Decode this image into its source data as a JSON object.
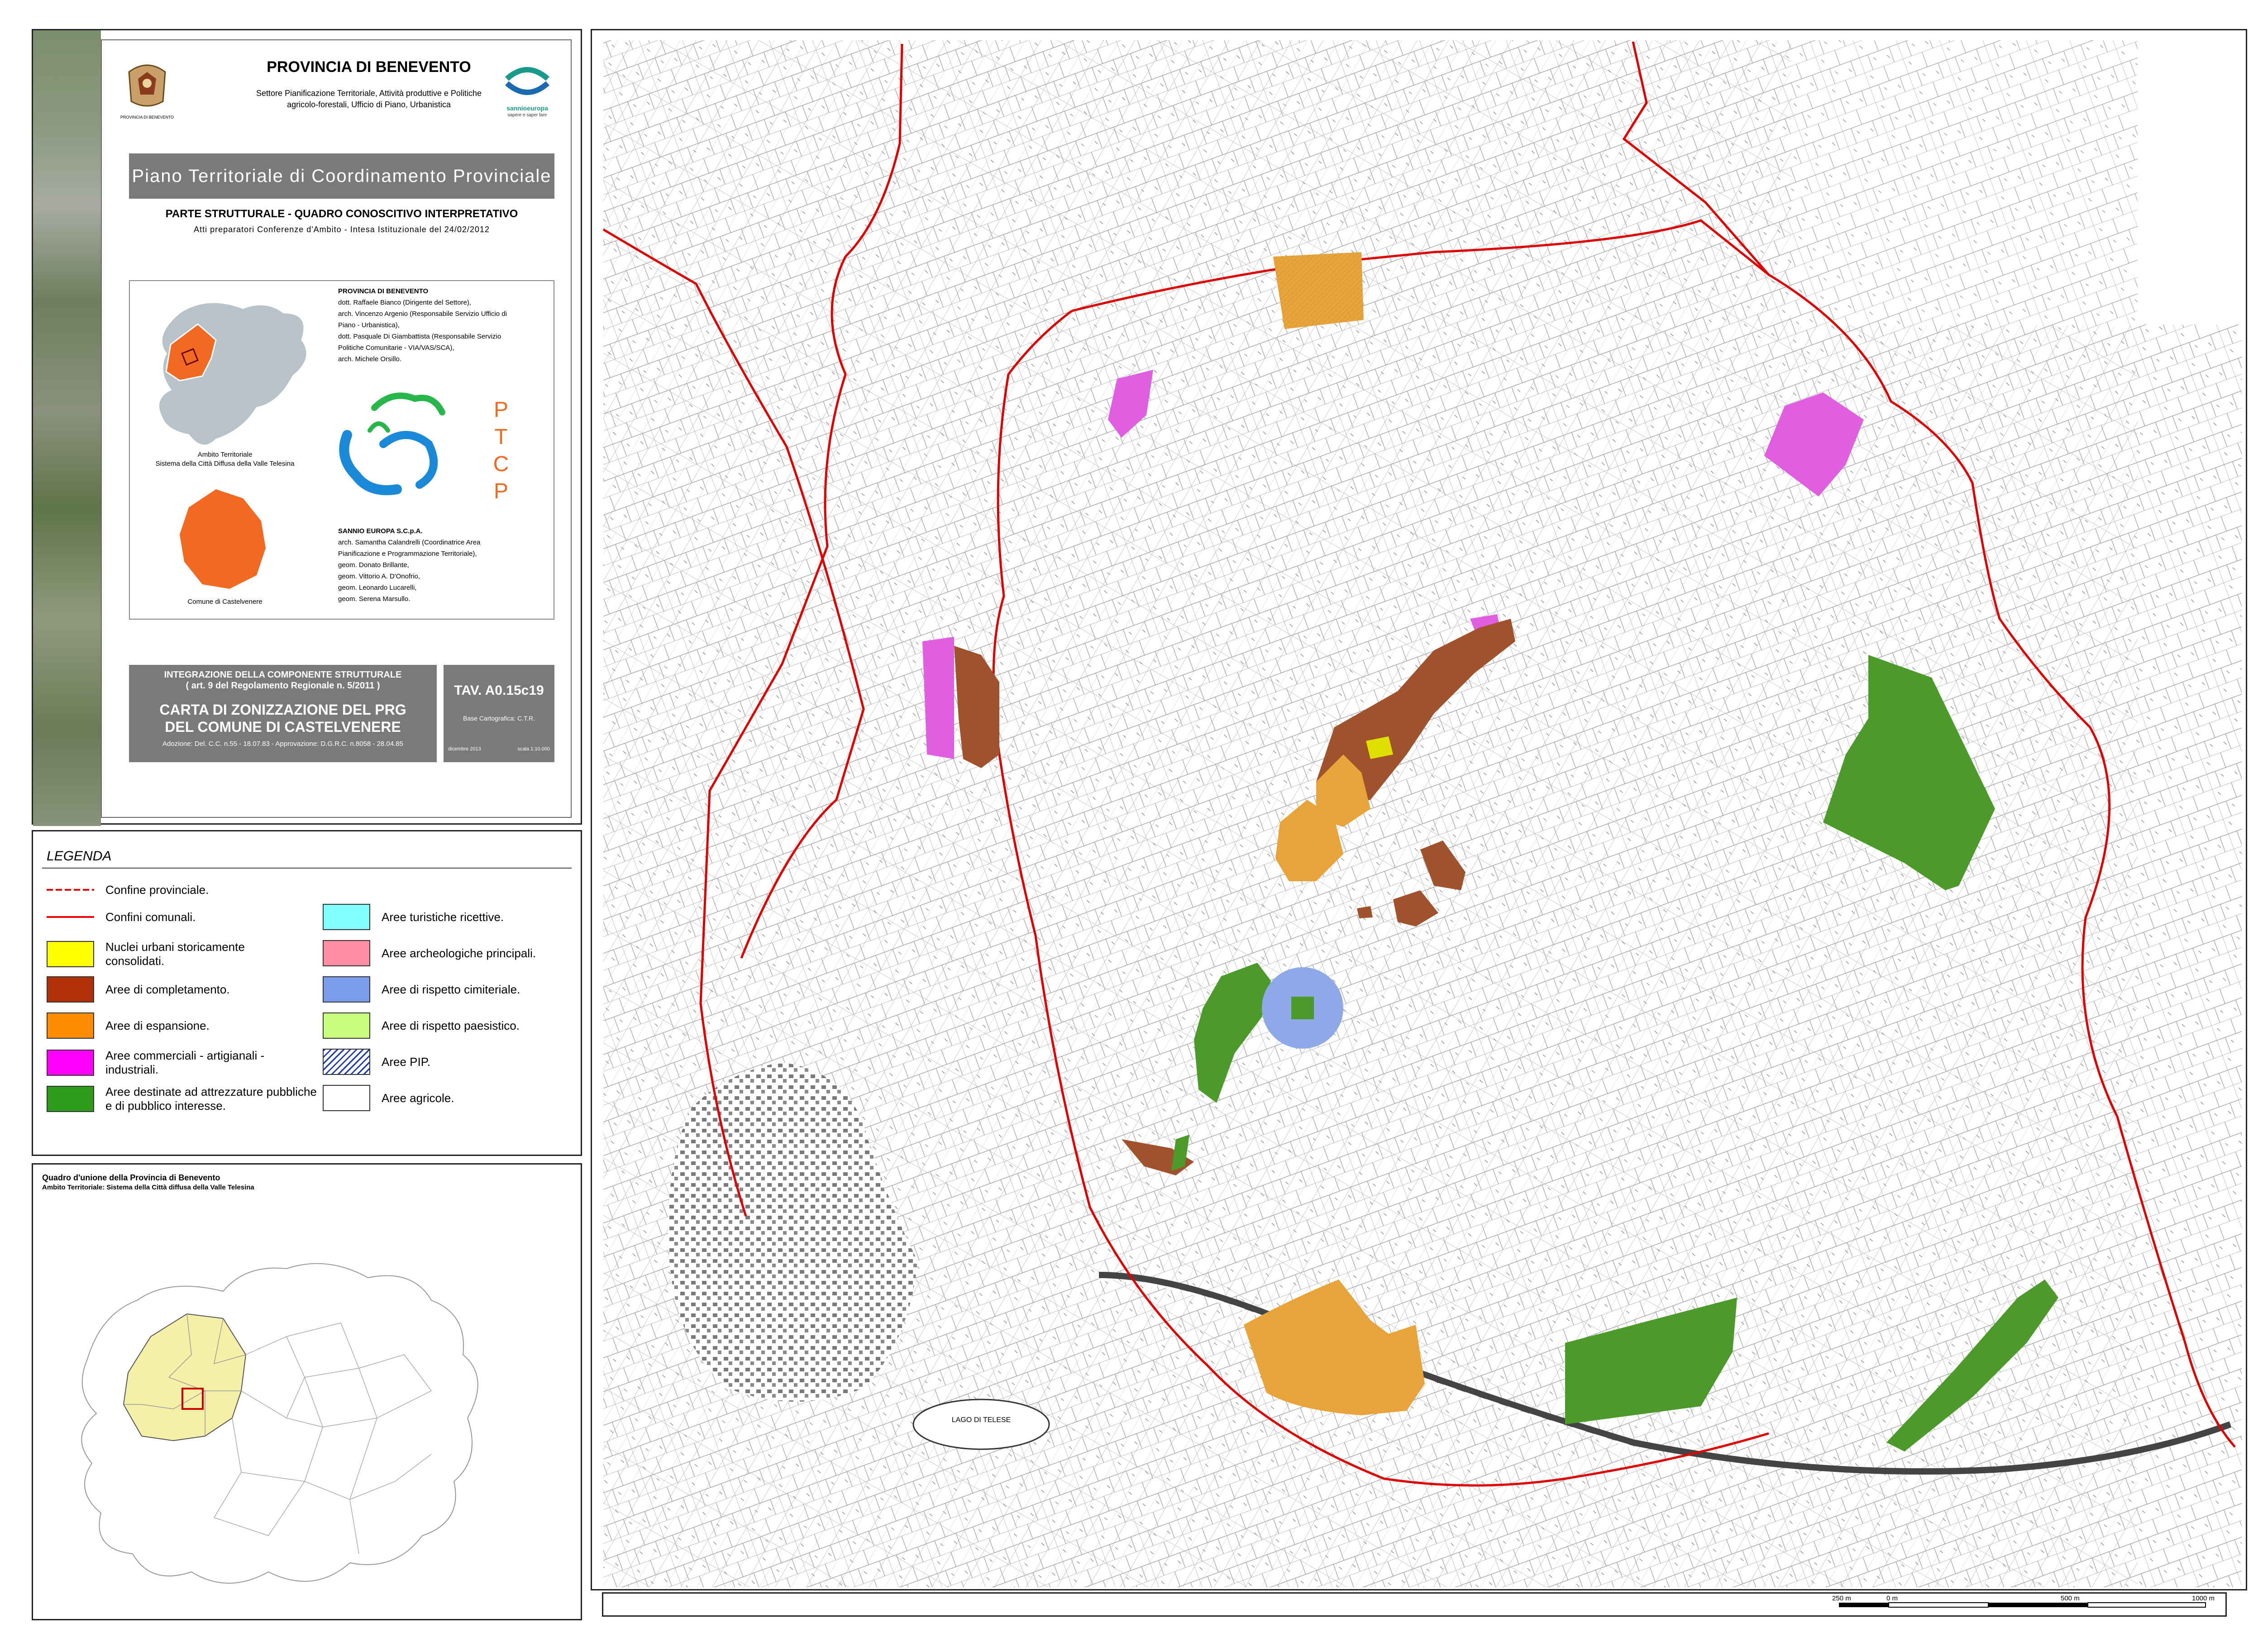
{
  "header": {
    "province": "PROVINCIA DI BENEVENTO",
    "sector": "Settore Pianificazione Territoriale, Attività produttive e Politiche agricolo-forestali, Ufficio di Piano, Urbanistica",
    "crest_caption": "PROVINCIA DI BENEVENTO",
    "logo_name": "sannioeuropa",
    "logo_tagline": "sapere e saper fare",
    "plan_title": "Piano Territoriale di Coordinamento Provinciale",
    "part_title": "PARTE STRUTTURALE - QUADRO CONOSCITIVO INTERPRETATIVO",
    "part_subtitle": "Atti preparatori Conferenze d'Ambito - Intesa Istituzionale del 24/02/2012"
  },
  "info": {
    "province_team_title": "PROVINCIA DI BENEVENTO",
    "province_team": [
      "dott. Raffaele Bianco (Dirigente del Settore),",
      "arch. Vincenzo Argenio (Responsabile Servizio Ufficio di",
      "Piano - Urbanistica),",
      "dott. Pasquale Di Giambattista (Responsabile Servizio",
      "Politiche Comunitarie - VIA/VAS/SCA),",
      "arch. Michele Orsillo."
    ],
    "sannio_team_title": "SANNIO EUROPA S.C.p.A.",
    "sannio_team": [
      "arch. Samantha Calandrelli (Coordinatrice Area",
      "Pianificazione e Programmazione Territoriale),",
      "geom. Donato Brillante,",
      "geom. Vittorio A. D'Onofrio,",
      "geom. Leonardo Lucarelli,",
      "geom. Serena Marsullo."
    ],
    "ambito_caption_1": "Ambito Territoriale",
    "ambito_caption_2": "Sistema della Città Diffusa della Valle Telesina",
    "comune_caption": "Comune di Castelvenere",
    "ptcp_letters": [
      "P",
      "T",
      "C",
      "P"
    ]
  },
  "tav": {
    "integration_1": "INTEGRAZIONE DELLA COMPONENTE STRUTTURALE",
    "integration_2": "( art. 9 del Regolamento Regionale n. 5/2011 )",
    "map_title_1": "CARTA DI ZONIZZAZIONE DEL PRG",
    "map_title_2": "DEL COMUNE DI CASTELVENERE",
    "adoption": "Adozione: Del. C.C. n.55 - 18.07.83 - Approvazione: D.G.R.C. n.8058 - 28.04.85",
    "tav_prefix": "TAV.",
    "tav_code": "A0.15c19",
    "base": "Base Cartografica: C.T.R.",
    "date": "dicembre 2013",
    "scale": "scala 1:10.000"
  },
  "legend": {
    "title": "LEGENDA",
    "lines": [
      {
        "label": "Confine provinciale.",
        "style": "dashed",
        "color": "#e00000"
      },
      {
        "label": "Confini comunali.",
        "style": "solid",
        "color": "#e00000"
      }
    ],
    "left_items": [
      {
        "label": "Nuclei urbani storicamente consolidati.",
        "color": "#ffff00"
      },
      {
        "label": "Aree di completamento.",
        "color": "#b0300a"
      },
      {
        "label": "Aree di espansione.",
        "color": "#ff8c00"
      },
      {
        "label": "Aree commerciali - artigianali - industriali.",
        "color": "#ff00ff"
      },
      {
        "label": "Aree destinate ad attrezzature pubbliche e di pubblico interesse.",
        "color": "#2e9a1c"
      }
    ],
    "right_items": [
      {
        "label": "Aree turistiche ricettive.",
        "color": "#80ffff"
      },
      {
        "label": "Aree archeologiche principali.",
        "color": "#ff8ca0"
      },
      {
        "label": "Aree di rispetto cimiteriale.",
        "color": "#7b9ceb"
      },
      {
        "label": "Aree di rispetto paesistico.",
        "color": "#c8ff80"
      },
      {
        "label": "Aree PIP.",
        "color": "#ffffff",
        "pattern": "hatch-blue"
      },
      {
        "label": "Aree agricole.",
        "color": "#ffffff"
      }
    ]
  },
  "overview": {
    "title": "Quadro d'unione della Provincia di Benevento",
    "subtitle": "Ambito Territoriale: Sistema della Città diffusa della Valle Telesina",
    "area_color": "#f5f0a8"
  },
  "map": {
    "lake_label": "LAGO DI TELESE",
    "zone_colors": {
      "expansion": "#e8a33a",
      "completion": "#a0522d",
      "commercial": "#e05fe0",
      "public": "#4c9a2a",
      "cemetery": "#8ea8e8",
      "historic": "#e0e000"
    }
  },
  "scale_bar": {
    "labels": [
      "250 m",
      "0 m",
      "500 m",
      "1000 m"
    ]
  }
}
